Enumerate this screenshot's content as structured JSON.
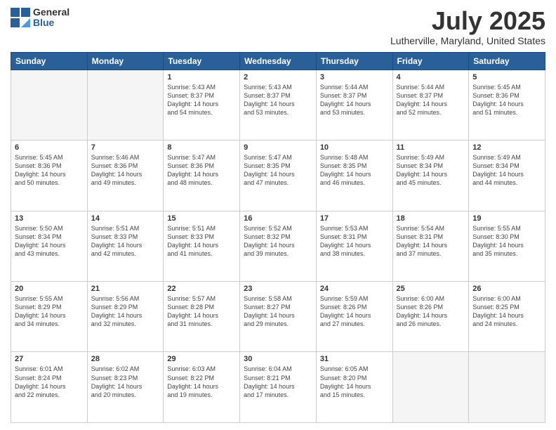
{
  "logo": {
    "general": "General",
    "blue": "Blue"
  },
  "title": "July 2025",
  "subtitle": "Lutherville, Maryland, United States",
  "days_of_week": [
    "Sunday",
    "Monday",
    "Tuesday",
    "Wednesday",
    "Thursday",
    "Friday",
    "Saturday"
  ],
  "weeks": [
    [
      {
        "day": "",
        "info": ""
      },
      {
        "day": "",
        "info": ""
      },
      {
        "day": "1",
        "info": "Sunrise: 5:43 AM\nSunset: 8:37 PM\nDaylight: 14 hours\nand 54 minutes."
      },
      {
        "day": "2",
        "info": "Sunrise: 5:43 AM\nSunset: 8:37 PM\nDaylight: 14 hours\nand 53 minutes."
      },
      {
        "day": "3",
        "info": "Sunrise: 5:44 AM\nSunset: 8:37 PM\nDaylight: 14 hours\nand 53 minutes."
      },
      {
        "day": "4",
        "info": "Sunrise: 5:44 AM\nSunset: 8:37 PM\nDaylight: 14 hours\nand 52 minutes."
      },
      {
        "day": "5",
        "info": "Sunrise: 5:45 AM\nSunset: 8:36 PM\nDaylight: 14 hours\nand 51 minutes."
      }
    ],
    [
      {
        "day": "6",
        "info": "Sunrise: 5:45 AM\nSunset: 8:36 PM\nDaylight: 14 hours\nand 50 minutes."
      },
      {
        "day": "7",
        "info": "Sunrise: 5:46 AM\nSunset: 8:36 PM\nDaylight: 14 hours\nand 49 minutes."
      },
      {
        "day": "8",
        "info": "Sunrise: 5:47 AM\nSunset: 8:36 PM\nDaylight: 14 hours\nand 48 minutes."
      },
      {
        "day": "9",
        "info": "Sunrise: 5:47 AM\nSunset: 8:35 PM\nDaylight: 14 hours\nand 47 minutes."
      },
      {
        "day": "10",
        "info": "Sunrise: 5:48 AM\nSunset: 8:35 PM\nDaylight: 14 hours\nand 46 minutes."
      },
      {
        "day": "11",
        "info": "Sunrise: 5:49 AM\nSunset: 8:34 PM\nDaylight: 14 hours\nand 45 minutes."
      },
      {
        "day": "12",
        "info": "Sunrise: 5:49 AM\nSunset: 8:34 PM\nDaylight: 14 hours\nand 44 minutes."
      }
    ],
    [
      {
        "day": "13",
        "info": "Sunrise: 5:50 AM\nSunset: 8:34 PM\nDaylight: 14 hours\nand 43 minutes."
      },
      {
        "day": "14",
        "info": "Sunrise: 5:51 AM\nSunset: 8:33 PM\nDaylight: 14 hours\nand 42 minutes."
      },
      {
        "day": "15",
        "info": "Sunrise: 5:51 AM\nSunset: 8:33 PM\nDaylight: 14 hours\nand 41 minutes."
      },
      {
        "day": "16",
        "info": "Sunrise: 5:52 AM\nSunset: 8:32 PM\nDaylight: 14 hours\nand 39 minutes."
      },
      {
        "day": "17",
        "info": "Sunrise: 5:53 AM\nSunset: 8:31 PM\nDaylight: 14 hours\nand 38 minutes."
      },
      {
        "day": "18",
        "info": "Sunrise: 5:54 AM\nSunset: 8:31 PM\nDaylight: 14 hours\nand 37 minutes."
      },
      {
        "day": "19",
        "info": "Sunrise: 5:55 AM\nSunset: 8:30 PM\nDaylight: 14 hours\nand 35 minutes."
      }
    ],
    [
      {
        "day": "20",
        "info": "Sunrise: 5:55 AM\nSunset: 8:29 PM\nDaylight: 14 hours\nand 34 minutes."
      },
      {
        "day": "21",
        "info": "Sunrise: 5:56 AM\nSunset: 8:29 PM\nDaylight: 14 hours\nand 32 minutes."
      },
      {
        "day": "22",
        "info": "Sunrise: 5:57 AM\nSunset: 8:28 PM\nDaylight: 14 hours\nand 31 minutes."
      },
      {
        "day": "23",
        "info": "Sunrise: 5:58 AM\nSunset: 8:27 PM\nDaylight: 14 hours\nand 29 minutes."
      },
      {
        "day": "24",
        "info": "Sunrise: 5:59 AM\nSunset: 8:26 PM\nDaylight: 14 hours\nand 27 minutes."
      },
      {
        "day": "25",
        "info": "Sunrise: 6:00 AM\nSunset: 8:26 PM\nDaylight: 14 hours\nand 26 minutes."
      },
      {
        "day": "26",
        "info": "Sunrise: 6:00 AM\nSunset: 8:25 PM\nDaylight: 14 hours\nand 24 minutes."
      }
    ],
    [
      {
        "day": "27",
        "info": "Sunrise: 6:01 AM\nSunset: 8:24 PM\nDaylight: 14 hours\nand 22 minutes."
      },
      {
        "day": "28",
        "info": "Sunrise: 6:02 AM\nSunset: 8:23 PM\nDaylight: 14 hours\nand 20 minutes."
      },
      {
        "day": "29",
        "info": "Sunrise: 6:03 AM\nSunset: 8:22 PM\nDaylight: 14 hours\nand 19 minutes."
      },
      {
        "day": "30",
        "info": "Sunrise: 6:04 AM\nSunset: 8:21 PM\nDaylight: 14 hours\nand 17 minutes."
      },
      {
        "day": "31",
        "info": "Sunrise: 6:05 AM\nSunset: 8:20 PM\nDaylight: 14 hours\nand 15 minutes."
      },
      {
        "day": "",
        "info": ""
      },
      {
        "day": "",
        "info": ""
      }
    ]
  ]
}
